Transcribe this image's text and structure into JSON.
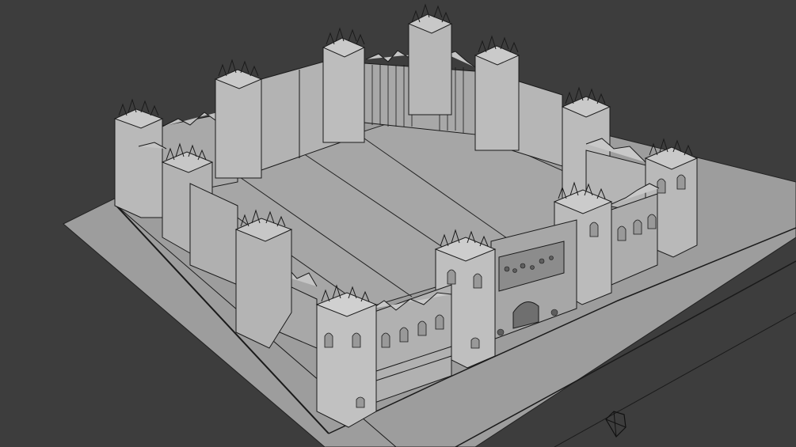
{
  "viewport": {
    "background": "#3d3d3d",
    "ground_color": "#9a9a9a",
    "floor_color": "#a3a3a3",
    "wall_light": "#b4b4b4",
    "wall_dark": "#8f8f8f",
    "edge_color": "#1a1a1a"
  },
  "icons": {
    "camera": "camera-gizmo-icon"
  }
}
